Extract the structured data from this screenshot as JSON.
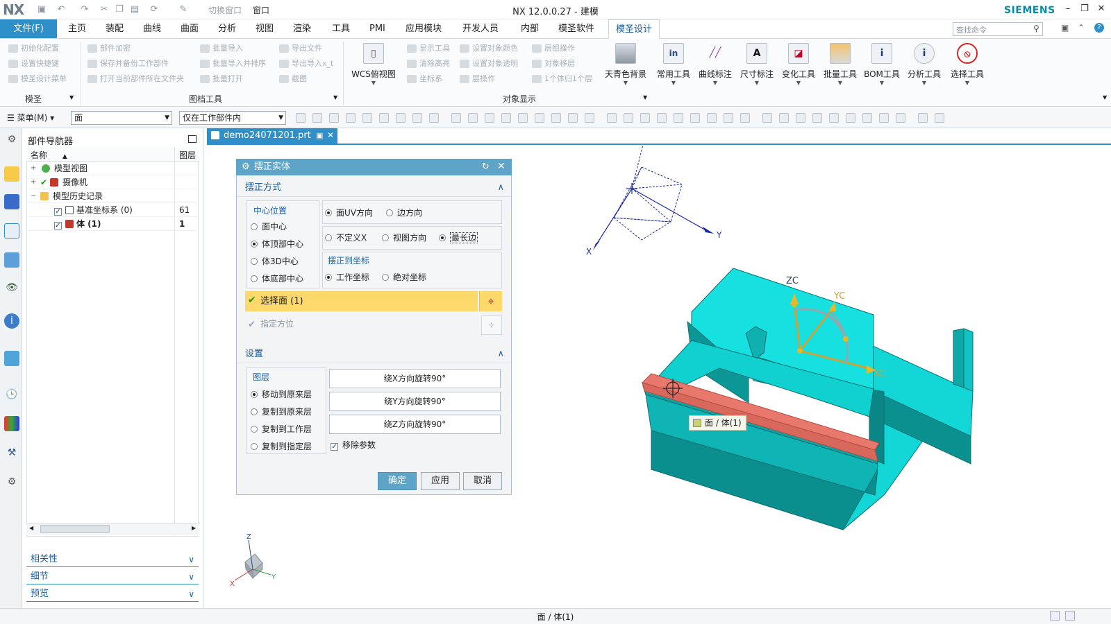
{
  "titlebar": {
    "logo": "NX",
    "switch_window": "切换窗口",
    "window_menu": "窗口",
    "title": "NX 12.0.0.27 - 建模",
    "brand": "SIEMENS"
  },
  "ribbon_tabs": [
    "文件(F)",
    "主页",
    "装配",
    "曲线",
    "曲面",
    "分析",
    "视图",
    "渲染",
    "工具",
    "PMI",
    "应用模块",
    "开发人员",
    "内部",
    "模圣软件",
    "模圣设计"
  ],
  "command_search_placeholder": "查找命令",
  "ribbon": {
    "group1": {
      "label": "模圣",
      "items": [
        "初始化配置",
        "设置快捷键",
        "模圣设计菜单"
      ]
    },
    "group2": {
      "label": "图档工具",
      "col1": [
        "部件加密",
        "保存并备份工作部件",
        "打开当前部件所在文件夹"
      ],
      "col2": [
        "批量导入",
        "批量导入并排序",
        "批量打开"
      ],
      "col3": [
        "导出文件",
        "导出导入x_t",
        "截图"
      ]
    },
    "group3": {
      "label": "对象显示",
      "col1": [
        "显示工具",
        "清除高亮",
        "坐标系"
      ],
      "col2": [
        "设置对象颜色",
        "设置对象透明",
        "层操作"
      ],
      "col3": [
        "层组操作",
        "对象移层",
        "1个体归1个层"
      ]
    },
    "wcs_button": "WCS俯视图",
    "big_buttons": [
      "天青色背景",
      "常用工具",
      "曲线标注",
      "尺寸标注",
      "变化工具",
      "批量工具",
      "BOM工具",
      "分析工具",
      "选择工具"
    ]
  },
  "toolbar": {
    "menu": "菜单(M)",
    "filter": "面",
    "scope": "仅在工作部件内"
  },
  "navigator": {
    "title": "部件导航器",
    "col_name": "名称",
    "col_layer": "图层",
    "rows": [
      {
        "label": "模型视图",
        "layer": ""
      },
      {
        "label": "摄像机",
        "layer": ""
      },
      {
        "label": "模型历史记录",
        "layer": ""
      },
      {
        "label": "基准坐标系 (0)",
        "layer": "61"
      },
      {
        "label": "体 (1)",
        "layer": "1"
      }
    ],
    "panels": [
      "相关性",
      "细节",
      "预览"
    ]
  },
  "document_tab": "demo24071201.prt",
  "dialog": {
    "title": "摆正实体",
    "section1": "摆正方式",
    "center_label": "中心位置",
    "center_options": [
      "面中心",
      "体顶部中心",
      "体3D中心",
      "体底部中心"
    ],
    "center_selected": 1,
    "dir_options": [
      "面UV方向",
      "边方向"
    ],
    "dir_options2": [
      "不定义X",
      "视图方向",
      "最长边"
    ],
    "align_label": "摆正到坐标",
    "coord_options": [
      "工作坐标",
      "绝对坐标"
    ],
    "select_face": "选择面 (1)",
    "specify_orient": "指定方位",
    "section2": "设置",
    "layer_label": "图层",
    "layer_options": [
      "移动到原来层",
      "复制到原来层",
      "复制到工作层",
      "复制到指定层"
    ],
    "rotate_buttons": [
      "绕X方向旋转90°",
      "绕Y方向旋转90°",
      "绕Z方向旋转90°"
    ],
    "remove_params": "移除参数",
    "ok": "确定",
    "apply": "应用",
    "cancel": "取消"
  },
  "viewport": {
    "tooltip": "面 / 体(1)",
    "axis_labels": {
      "zc": "ZC",
      "yc": "YC",
      "xc": "XC",
      "x": "X",
      "y": "Y",
      "z": "Z"
    }
  },
  "status": "面 / 体(1)",
  "colors": {
    "accent": "#2f8fc9",
    "model": "#19d8d8",
    "highlight_face": "#e8786c",
    "selection": "#fdd96b"
  }
}
